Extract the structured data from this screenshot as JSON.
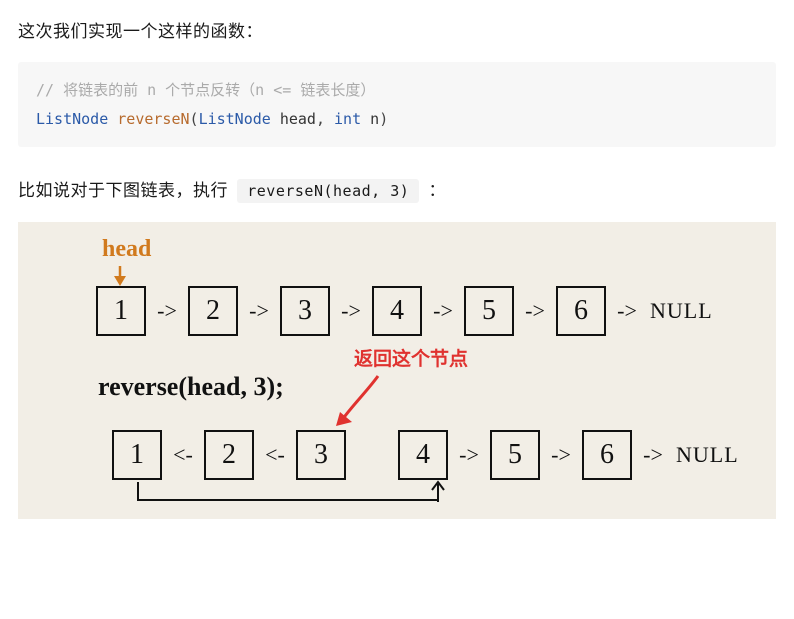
{
  "paragraph1": "这次我们实现一个这样的函数：",
  "code": {
    "comment": "//  将链表的前 n 个节点反转（n <= 链表长度）",
    "type1": "ListNode",
    "fn": "reverseN",
    "type2": "ListNode",
    "arg1": "head",
    "comma": ",",
    "kw_int": "int",
    "arg2": "n",
    "open": "(",
    "close": ")"
  },
  "paragraph2_prefix": "比如说对于下图链表，执行 ",
  "inline_code": "reverseN(head, 3)",
  "paragraph2_suffix": " ：",
  "figure": {
    "head_label": "head",
    "nodes": [
      "1",
      "2",
      "3",
      "4",
      "5",
      "6"
    ],
    "arrow_fwd": "->",
    "arrow_back": "<-",
    "null_label": "NULL",
    "arrow_null": "-> ",
    "call_text": "reverse(head, 3);",
    "red_text": "返回这个节点"
  }
}
